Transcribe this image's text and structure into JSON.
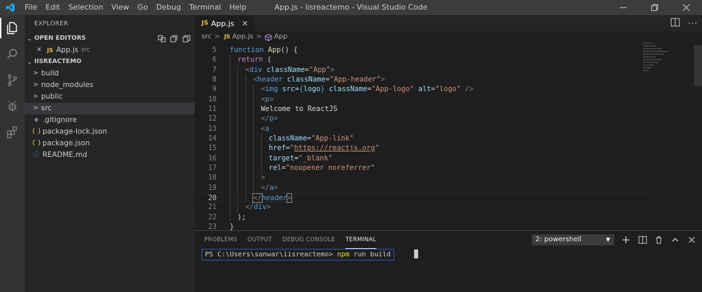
{
  "titlebar": {
    "menu": [
      "File",
      "Edit",
      "Selection",
      "View",
      "Go",
      "Debug",
      "Terminal",
      "Help"
    ],
    "title": "App.js - iisreactemo - Visual Studio Code"
  },
  "activity_bar": [
    "files-icon",
    "search-icon",
    "source-control-icon",
    "debug-icon",
    "extensions-icon"
  ],
  "sidebar": {
    "title": "EXPLORER",
    "open_editors_label": "OPEN EDITORS",
    "open_editors": [
      {
        "name": "App.js",
        "desc": "src",
        "icon": "JS"
      }
    ],
    "project_label": "IISREACTEMO",
    "tree": [
      {
        "name": "build",
        "type": "folder"
      },
      {
        "name": "node_modules",
        "type": "folder"
      },
      {
        "name": "public",
        "type": "folder"
      },
      {
        "name": "src",
        "type": "folder",
        "selected": true
      },
      {
        "name": ".gitignore",
        "type": "file",
        "icon": "◆"
      },
      {
        "name": "package-lock.json",
        "type": "file",
        "icon": "{ }"
      },
      {
        "name": "package.json",
        "type": "file",
        "icon": "{ }"
      },
      {
        "name": "README.md",
        "type": "file",
        "icon": "ⓘ"
      }
    ]
  },
  "editor": {
    "tab_label": "App.js",
    "tab_badge": "JS",
    "breadcrumb": {
      "folder": "src",
      "file": "App.js",
      "symbol": "App"
    },
    "current_line": 20,
    "lines": [
      {
        "n": 5,
        "indent": 0,
        "tokens": [
          [
            "kw",
            "function "
          ],
          [
            "fn",
            "App"
          ],
          [
            "tx",
            "() {"
          ]
        ]
      },
      {
        "n": 6,
        "indent": 1,
        "tokens": [
          [
            "ctl",
            "return "
          ],
          [
            "tx",
            "("
          ]
        ]
      },
      {
        "n": 7,
        "indent": 2,
        "tokens": [
          [
            "pu",
            "<"
          ],
          [
            "tg",
            "div "
          ],
          [
            "at",
            "className"
          ],
          [
            "tx",
            "="
          ],
          [
            "st",
            "\"App\""
          ],
          [
            "pu",
            ">"
          ]
        ]
      },
      {
        "n": 8,
        "indent": 3,
        "tokens": [
          [
            "pu",
            "<"
          ],
          [
            "tg",
            "header "
          ],
          [
            "at",
            "className"
          ],
          [
            "tx",
            "="
          ],
          [
            "st",
            "\"App-header\""
          ],
          [
            "pu",
            ">"
          ]
        ]
      },
      {
        "n": 9,
        "indent": 4,
        "tokens": [
          [
            "pu",
            "<"
          ],
          [
            "tg",
            "img "
          ],
          [
            "at",
            "src"
          ],
          [
            "tx",
            "="
          ],
          [
            "bv",
            "{"
          ],
          [
            "at",
            "logo"
          ],
          [
            "bv",
            "}"
          ],
          [
            "tx",
            " "
          ],
          [
            "at",
            "className"
          ],
          [
            "tx",
            "="
          ],
          [
            "st",
            "\"App-logo\""
          ],
          [
            "tx",
            " "
          ],
          [
            "at",
            "alt"
          ],
          [
            "tx",
            "="
          ],
          [
            "st",
            "\"logo\""
          ],
          [
            "tx",
            " "
          ],
          [
            "pu",
            "/>"
          ]
        ]
      },
      {
        "n": 10,
        "indent": 4,
        "tokens": [
          [
            "pu",
            "<"
          ],
          [
            "tg",
            "p"
          ],
          [
            "pu",
            ">"
          ]
        ]
      },
      {
        "n": 11,
        "indent": 4,
        "tokens": [
          [
            "tx",
            "Welcome to ReactJS"
          ]
        ]
      },
      {
        "n": 12,
        "indent": 4,
        "tokens": [
          [
            "pu",
            "</"
          ],
          [
            "tg",
            "p"
          ],
          [
            "pu",
            ">"
          ]
        ]
      },
      {
        "n": 13,
        "indent": 4,
        "tokens": [
          [
            "pu",
            "<"
          ],
          [
            "tg",
            "a"
          ]
        ]
      },
      {
        "n": 14,
        "indent": 5,
        "tokens": [
          [
            "at",
            "className"
          ],
          [
            "tx",
            "="
          ],
          [
            "st",
            "\"App-link\""
          ]
        ]
      },
      {
        "n": 15,
        "indent": 5,
        "tokens": [
          [
            "at",
            "href"
          ],
          [
            "tx",
            "="
          ],
          [
            "st",
            "\""
          ],
          [
            "st lnk",
            "https://reactjs.org"
          ],
          [
            "st",
            "\""
          ]
        ]
      },
      {
        "n": 16,
        "indent": 5,
        "tokens": [
          [
            "at",
            "target"
          ],
          [
            "tx",
            "="
          ],
          [
            "st",
            "\"_blank\""
          ]
        ]
      },
      {
        "n": 17,
        "indent": 5,
        "tokens": [
          [
            "at",
            "rel"
          ],
          [
            "tx",
            "="
          ],
          [
            "st",
            "\"noopener noreferrer\""
          ]
        ]
      },
      {
        "n": 18,
        "indent": 4,
        "tokens": [
          [
            "pu",
            ">"
          ]
        ]
      },
      {
        "n": 19,
        "indent": 4,
        "tokens": [
          [
            "pu",
            "</"
          ],
          [
            "tg",
            "a"
          ],
          [
            "pu",
            ">"
          ]
        ]
      },
      {
        "n": 20,
        "indent": 3,
        "tokens": [
          [
            "pu",
            "</"
          ],
          [
            "tg",
            "header"
          ],
          [
            "pu",
            ">"
          ]
        ]
      },
      {
        "n": 21,
        "indent": 2,
        "tokens": [
          [
            "pu",
            "</"
          ],
          [
            "tg",
            "div"
          ],
          [
            "pu",
            ">"
          ]
        ]
      },
      {
        "n": 22,
        "indent": 1,
        "tokens": [
          [
            "tx",
            ");"
          ]
        ]
      },
      {
        "n": 23,
        "indent": 0,
        "tokens": [
          [
            "tx",
            "}"
          ]
        ]
      }
    ]
  },
  "panel": {
    "tabs": [
      "PROBLEMS",
      "OUTPUT",
      "DEBUG CONSOLE",
      "TERMINAL"
    ],
    "active_tab": "TERMINAL",
    "terminal_select": "2: powershell",
    "prompt": "PS C:\\Users\\sanwar\\iisreactemo> ",
    "command": "npm",
    "args": " run build"
  }
}
